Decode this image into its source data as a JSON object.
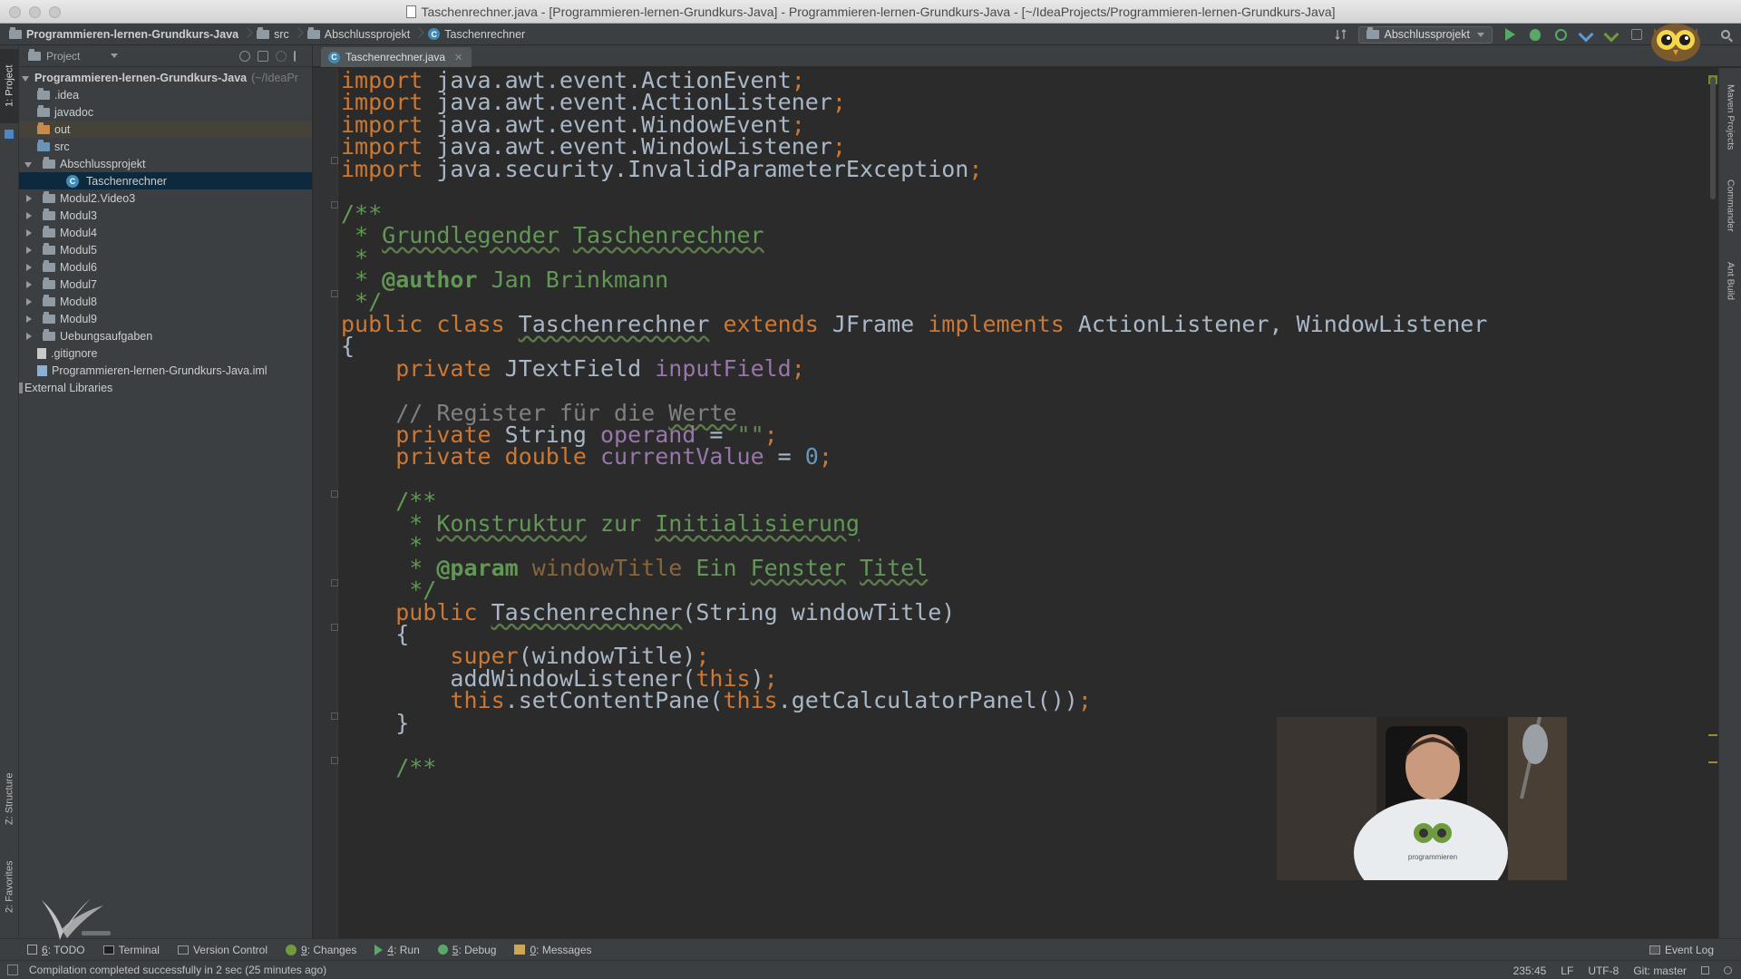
{
  "window": {
    "title": "Taschenrechner.java - [Programmieren-lernen-Grundkurs-Java] - Programmieren-lernen-Grundkurs-Java - [~/IdeaProjects/Programmieren-lernen-Grundkurs-Java]"
  },
  "breadcrumbs": [
    {
      "label": "Programmieren-lernen-Grundkurs-Java",
      "icon": "folder-icon"
    },
    {
      "label": "src",
      "icon": "folder-icon"
    },
    {
      "label": "Abschlussprojekt",
      "icon": "folder-icon"
    },
    {
      "label": "Taschenrechner",
      "icon": "class-icon"
    }
  ],
  "toolbar": {
    "run_config": "Abschlussprojekt"
  },
  "left_strip": {
    "project_tab": "1: Project",
    "structure_tab": "Z: Structure",
    "favorites_tab": "2: Favorites"
  },
  "project_panel": {
    "view_label": "Project",
    "tree": [
      {
        "label": "Programmieren-lernen-Grundkurs-Java",
        "suffix": "(~/IdeaPr",
        "bold": true
      },
      {
        "label": ".idea"
      },
      {
        "label": "javadoc"
      },
      {
        "label": "out"
      },
      {
        "label": "src"
      },
      {
        "label": "Abschlussprojekt"
      },
      {
        "label": "Taschenrechner",
        "selected": true
      },
      {
        "label": "Modul2.Video3"
      },
      {
        "label": "Modul3"
      },
      {
        "label": "Modul4"
      },
      {
        "label": "Modul5"
      },
      {
        "label": "Modul6"
      },
      {
        "label": "Modul7"
      },
      {
        "label": "Modul8"
      },
      {
        "label": "Modul9"
      },
      {
        "label": "Uebungsaufgaben"
      },
      {
        "label": ".gitignore"
      },
      {
        "label": "Programmieren-lernen-Grundkurs-Java.iml"
      },
      {
        "label": "External Libraries"
      }
    ]
  },
  "editor": {
    "tab_label": "Taschenrechner.java",
    "lines": [
      [
        [
          "kw",
          "import "
        ],
        [
          "pl",
          "java.awt.event.ActionEvent"
        ],
        [
          "kw",
          ";"
        ]
      ],
      [
        [
          "kw",
          "import "
        ],
        [
          "pl",
          "java.awt.event.ActionListener"
        ],
        [
          "kw",
          ";"
        ]
      ],
      [
        [
          "kw",
          "import "
        ],
        [
          "pl",
          "java.awt.event.WindowEvent"
        ],
        [
          "kw",
          ";"
        ]
      ],
      [
        [
          "kw",
          "import "
        ],
        [
          "pl",
          "java.awt.event.WindowListener"
        ],
        [
          "kw",
          ";"
        ]
      ],
      [
        [
          "kw",
          "import "
        ],
        [
          "pl",
          "java.security.InvalidParameterException"
        ],
        [
          "kw",
          ";"
        ]
      ],
      [],
      [
        [
          "cmt",
          "/**"
        ]
      ],
      [
        [
          "cmt",
          " * "
        ],
        [
          "cmt_u",
          "Grundlegender"
        ],
        [
          "cmt",
          " "
        ],
        [
          "cmt_u",
          "Taschenrechner"
        ]
      ],
      [
        [
          "cmt",
          " *"
        ]
      ],
      [
        [
          "cmt",
          " * "
        ],
        [
          "tag",
          "@author"
        ],
        [
          "cmt",
          " Jan Brinkmann"
        ]
      ],
      [
        [
          "cmt",
          " */"
        ]
      ],
      [
        [
          "kw",
          "public class "
        ],
        [
          "pl_u",
          "Taschenrechner"
        ],
        [
          "pl",
          " "
        ],
        [
          "kw",
          "extends "
        ],
        [
          "pl",
          "JFrame "
        ],
        [
          "kw",
          "implements "
        ],
        [
          "pl",
          "ActionListener, WindowListener"
        ]
      ],
      [
        [
          "pl",
          "{"
        ]
      ],
      [
        [
          "pl",
          "    "
        ],
        [
          "kw",
          "private "
        ],
        [
          "pl",
          "JTextField "
        ],
        [
          "fld",
          "inputField"
        ],
        [
          "kw",
          ";"
        ]
      ],
      [],
      [
        [
          "lc",
          "    // Register für die "
        ],
        [
          "lc_u",
          "Werte"
        ]
      ],
      [
        [
          "pl",
          "    "
        ],
        [
          "kw",
          "private "
        ],
        [
          "pl",
          "String "
        ],
        [
          "fld",
          "operand"
        ],
        [
          "pl",
          " = "
        ],
        [
          "str",
          "\"\""
        ],
        [
          "kw",
          ";"
        ]
      ],
      [
        [
          "pl",
          "    "
        ],
        [
          "kw",
          "private double "
        ],
        [
          "fld",
          "currentValue"
        ],
        [
          "pl",
          " = "
        ],
        [
          "num",
          "0"
        ],
        [
          "kw",
          ";"
        ]
      ],
      [],
      [
        [
          "cmt",
          "    /**"
        ]
      ],
      [
        [
          "cmt",
          "     * "
        ],
        [
          "cmt_u",
          "Konstruktur"
        ],
        [
          "cmt",
          " zur "
        ],
        [
          "cmt_u",
          "Initialisierung"
        ]
      ],
      [
        [
          "cmt",
          "     *"
        ]
      ],
      [
        [
          "cmt",
          "     * "
        ],
        [
          "tag",
          "@param "
        ],
        [
          "pname",
          "windowTitle"
        ],
        [
          "cmt",
          " Ein "
        ],
        [
          "cmt_u",
          "Fenster"
        ],
        [
          "cmt",
          " "
        ],
        [
          "cmt_u",
          "Titel"
        ]
      ],
      [
        [
          "cmt",
          "     */"
        ]
      ],
      [
        [
          "pl",
          "    "
        ],
        [
          "kw",
          "public "
        ],
        [
          "pl_u",
          "Taschenrechner"
        ],
        [
          "pl",
          "(String windowTitle)"
        ]
      ],
      [
        [
          "pl",
          "    {"
        ]
      ],
      [
        [
          "pl",
          "        "
        ],
        [
          "kw",
          "super"
        ],
        [
          "pl",
          "(windowTitle)"
        ],
        [
          "kw",
          ";"
        ]
      ],
      [
        [
          "pl",
          "        addWindowListener("
        ],
        [
          "kw",
          "this"
        ],
        [
          "pl",
          ")"
        ],
        [
          "kw",
          ";"
        ]
      ],
      [
        [
          "pl",
          "        "
        ],
        [
          "kw",
          "this"
        ],
        [
          "pl",
          ".setContentPane("
        ],
        [
          "kw",
          "this"
        ],
        [
          "pl",
          ".getCalculatorPanel())"
        ],
        [
          "kw",
          ";"
        ]
      ],
      [
        [
          "pl",
          "    }"
        ]
      ],
      [],
      [
        [
          "cmt",
          "    /**"
        ]
      ]
    ]
  },
  "right_strip": {
    "maven_tab": "Maven Projects",
    "commander_tab": "Commander",
    "ant_tab": "Ant Build"
  },
  "tool_windows": [
    {
      "mnemonic": "6",
      "label": ": TODO",
      "icon": "todo-icon"
    },
    {
      "mnemonic": "",
      "label": "Terminal",
      "icon": "terminal-icon"
    },
    {
      "mnemonic": "",
      "label": "Version Control",
      "icon": "version-control-icon"
    },
    {
      "mnemonic": "9",
      "label": ": Changes",
      "icon": "changes-icon"
    },
    {
      "mnemonic": "4",
      "label": ": Run",
      "icon": "run-icon"
    },
    {
      "mnemonic": "5",
      "label": ": Debug",
      "icon": "debug-icon"
    },
    {
      "mnemonic": "0",
      "label": ": Messages",
      "icon": "messages-icon"
    }
  ],
  "event_log": "Event Log",
  "status": {
    "message": "Compilation completed successfully in 2 sec (25 minutes ago)",
    "position": "235:45",
    "line_sep": "LF",
    "encoding": "UTF-8",
    "git": "Git: master"
  },
  "webcam": {
    "hoodie_text": "programmieren"
  },
  "colors": {
    "keyword": "#cc7832",
    "plain": "#a9b7c6",
    "doc_comment": "#629755",
    "line_comment": "#808080",
    "field": "#9876aa",
    "string": "#6a8759",
    "number": "#6897bb",
    "selection": "#0d293e"
  }
}
